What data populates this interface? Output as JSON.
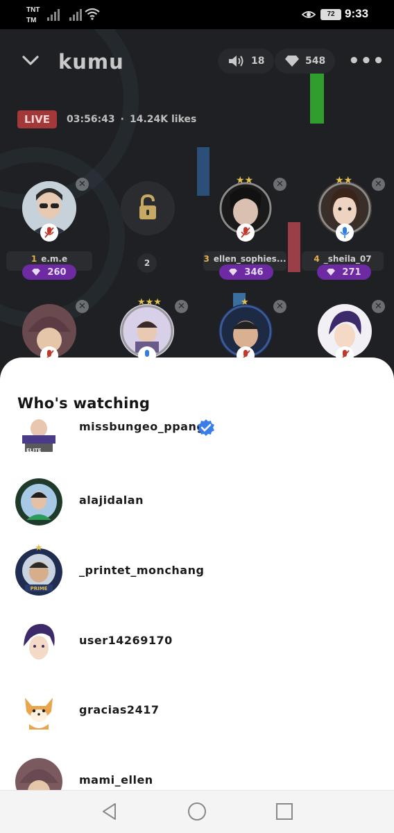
{
  "status_bar": {
    "carrier_line1": "TNT",
    "carrier_line2": "TM",
    "battery": "72",
    "time": "9:33"
  },
  "room": {
    "name": "kumu",
    "speaker_count": "18",
    "gem_count": "548",
    "live_label": "LIVE",
    "duration": "03:56:43",
    "separator": "·",
    "likes": "14.24K likes",
    "seats": [
      {
        "num": "1",
        "name": "e.m.e",
        "gems": "260",
        "mic": "muted"
      },
      {
        "num": "2",
        "name": "",
        "gems": "",
        "mic": "locked"
      },
      {
        "num": "3",
        "name": "ellen_sophies...",
        "gems": "346",
        "mic": "muted"
      },
      {
        "num": "4",
        "name": "_sheila_07",
        "gems": "271",
        "mic": "active"
      }
    ]
  },
  "sheet": {
    "title": "Who's watching",
    "viewers": [
      {
        "name": "missbungeo_ppang",
        "verified": true,
        "avatar_badge": "ELITE"
      },
      {
        "name": "alajidalan"
      },
      {
        "name": "_printet_monchang",
        "avatar_badge": "PRIME"
      },
      {
        "name": "user14269170"
      },
      {
        "name": "gracias2417"
      },
      {
        "name": "mami_ellen"
      }
    ]
  },
  "colors": {
    "live_red": "#a33838",
    "gem_purple": "#6d2aa3",
    "verified_blue": "#3a7de8"
  }
}
